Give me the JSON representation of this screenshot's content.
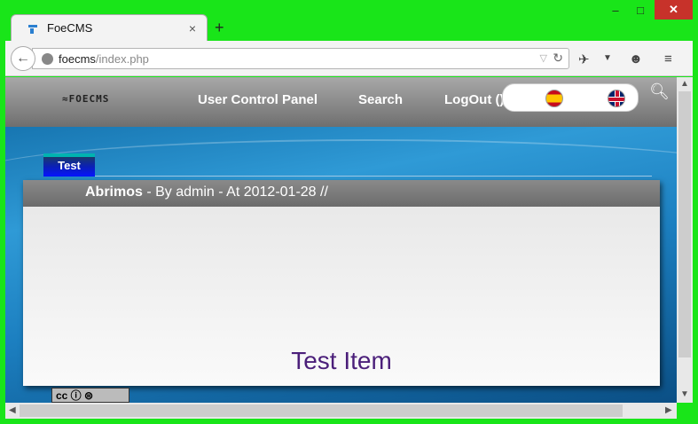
{
  "browser": {
    "tab_title": "FoeCMS",
    "url_host": "foecms",
    "url_path": "/index.php",
    "new_tab": "+",
    "tab_close": "×",
    "win_min": "–",
    "win_max": "□",
    "win_close": "✕"
  },
  "site": {
    "logo": "≈FOECMS",
    "nav": {
      "user_panel": "User Control Panel",
      "search": "Search",
      "logout": "LogOut ()"
    },
    "languages": [
      "es",
      "en"
    ],
    "page_tab": "Test"
  },
  "post": {
    "title": "Abrimos",
    "meta": " - By admin - At 2012-01-28 //",
    "body_title": "Test Item"
  },
  "footer": {
    "cc_label": "cc ⓘ ⊜"
  },
  "colors": {
    "window_frame": "#19e519",
    "accent_text": "#4b1f7a",
    "close_button": "#c7322a"
  }
}
